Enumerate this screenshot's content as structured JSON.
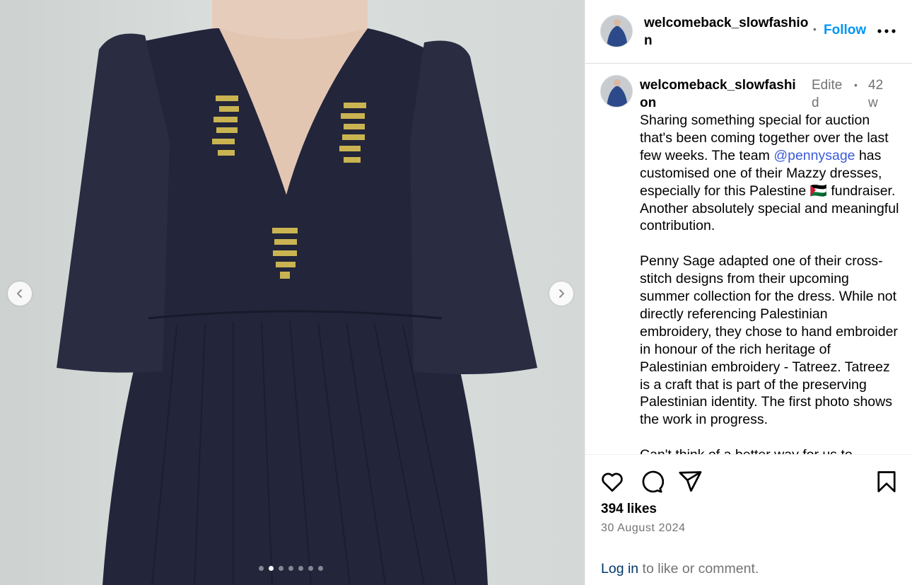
{
  "post": {
    "username": "welcomeback_slowfashion",
    "follow_separator": "•",
    "follow_label": "Follow",
    "more_icon": "more-horizontal-icon",
    "image_count": 7,
    "active_image_index": 1
  },
  "caption": {
    "username": "welcomeback_slowfashion",
    "edited_label": "Edited",
    "separator": "•",
    "time_ago": "42 w",
    "paragraph1_part1": "Sharing something special for auction that's been coming together over the last few weeks. The team ",
    "mention": "@pennysage",
    "paragraph1_part2": " has customised one of their Mazzy dresses, especially for this Palestine 🇵🇸 fundraiser.  Another absolutely special and meaningful contribution.",
    "paragraph2": "Penny Sage adapted one of their cross-stitch designs from their upcoming summer collection for the dress.  While not directly referencing Palestinian embroidery,  they chose to hand embroider  in honour of the rich heritage of Palestinian embroidery - Tatreez. Tatreez is a craft that is part of the preserving Palestinian identity.  The first photo shows the work in progress.",
    "paragraph3": "Can't  think of a  better way for us to"
  },
  "engagement": {
    "likes_count": "394",
    "likes_label": "likes",
    "date": "30 August 2024",
    "login_link": "Log in",
    "login_suffix": " to like or comment."
  },
  "icons": {
    "like": "heart-icon",
    "comment": "comment-icon",
    "share": "share-icon",
    "save": "bookmark-icon",
    "prev": "chevron-left-icon",
    "next": "chevron-right-icon"
  },
  "colors": {
    "follow": "#0095f6",
    "mention": "#3b5bdb",
    "muted": "#737373",
    "login_link": "#00376b"
  }
}
